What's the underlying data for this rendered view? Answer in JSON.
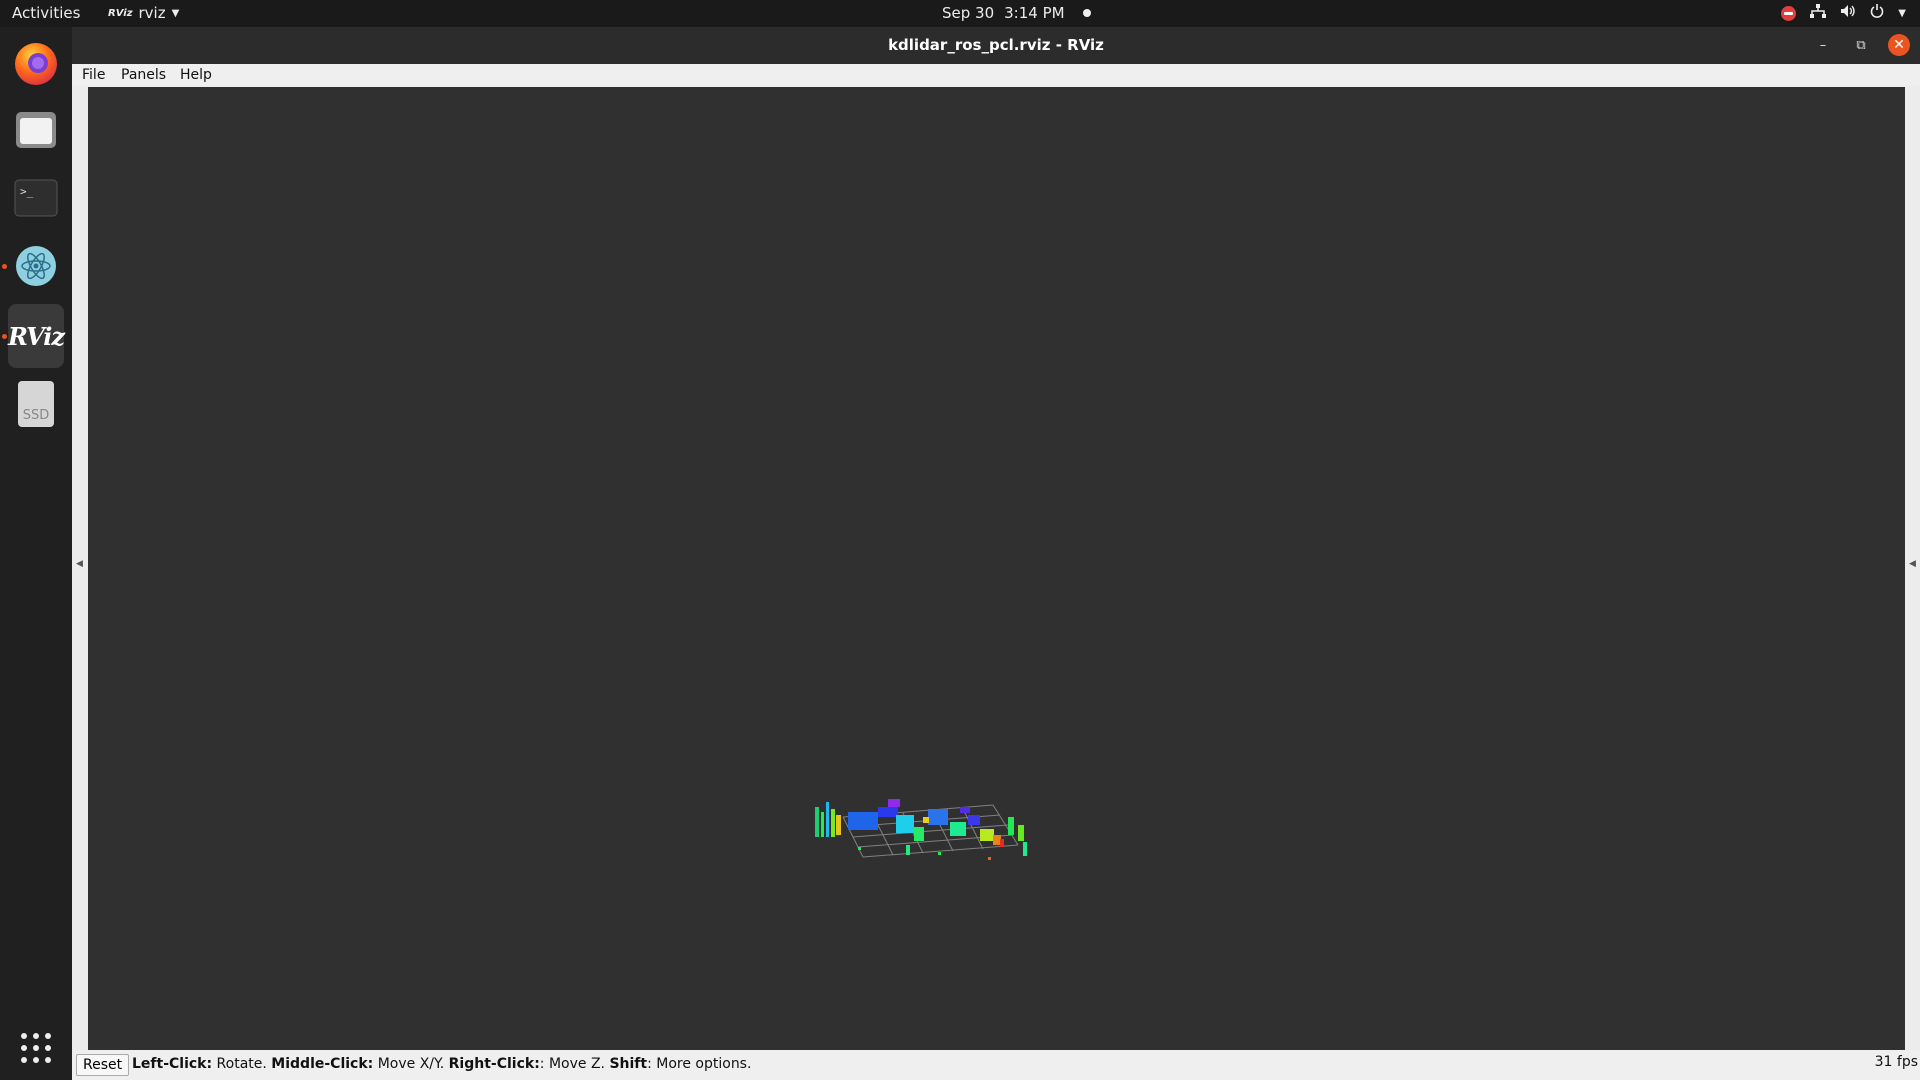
{
  "topbar": {
    "activities": "Activities",
    "app_name": "rviz",
    "date": "Sep 30",
    "time": "3:14 PM"
  },
  "dock": {
    "items": [
      "firefox-icon",
      "files-icon",
      "terminal-icon",
      "atom-icon",
      "rviz-icon",
      "ssd-drive-icon",
      "app-grid-icon"
    ],
    "ssd_label": "SSD",
    "rviz_label": "RViz"
  },
  "window": {
    "title": "kdlidar_ros_pcl.rviz - RViz",
    "menu": {
      "file": "File",
      "panels": "Panels",
      "help": "Help"
    },
    "status": {
      "reset": "Reset",
      "left_click_key": "Left-Click:",
      "left_click_val": "Rotate.",
      "middle_click_key": "Middle-Click:",
      "middle_click_val": "Move X/Y.",
      "right_click_key": "Right-Click:",
      "right_click_val": ": Move Z.",
      "shift_key": "Shift",
      "shift_val": ": More options.",
      "fps": "31 fps"
    }
  },
  "colors": {
    "viewport_bg": "#303030",
    "accent": "#e95420"
  }
}
